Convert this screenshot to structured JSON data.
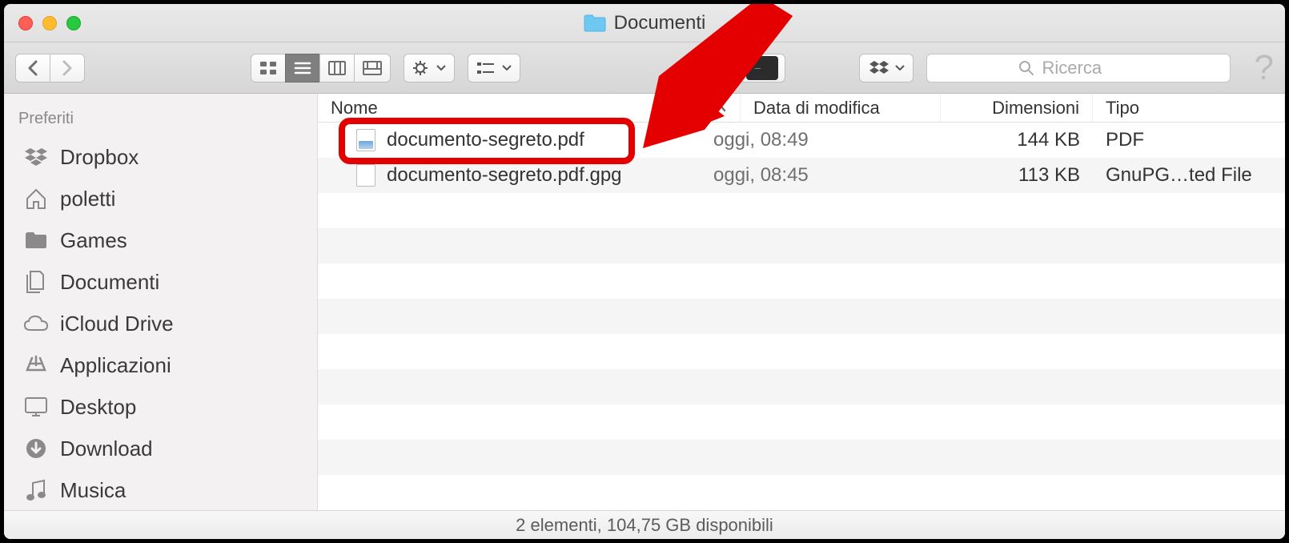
{
  "window": {
    "title": "Documenti"
  },
  "toolbar": {
    "search_placeholder": "Ricerca"
  },
  "sidebar": {
    "section": "Preferiti",
    "items": [
      {
        "label": "Dropbox",
        "icon": "dropbox-icon"
      },
      {
        "label": "poletti",
        "icon": "home-icon"
      },
      {
        "label": "Games",
        "icon": "folder-icon"
      },
      {
        "label": "Documenti",
        "icon": "documents-icon"
      },
      {
        "label": "iCloud Drive",
        "icon": "cloud-icon"
      },
      {
        "label": "Applicazioni",
        "icon": "apps-icon"
      },
      {
        "label": "Desktop",
        "icon": "desktop-icon"
      },
      {
        "label": "Download",
        "icon": "download-icon"
      },
      {
        "label": "Musica",
        "icon": "music-icon"
      }
    ]
  },
  "columns": {
    "name": "Nome",
    "date": "Data di modifica",
    "size": "Dimensioni",
    "kind": "Tipo"
  },
  "files": [
    {
      "name": "documento-segreto.pdf",
      "date": "oggi, 08:49",
      "size": "144 KB",
      "kind": "PDF",
      "icon": "pdf"
    },
    {
      "name": "documento-segreto.pdf.gpg",
      "date": "oggi, 08:45",
      "size": "113 KB",
      "kind": "GnuPG…ted File",
      "icon": "generic"
    }
  ],
  "status": "2 elementi, 104,75 GB disponibili"
}
